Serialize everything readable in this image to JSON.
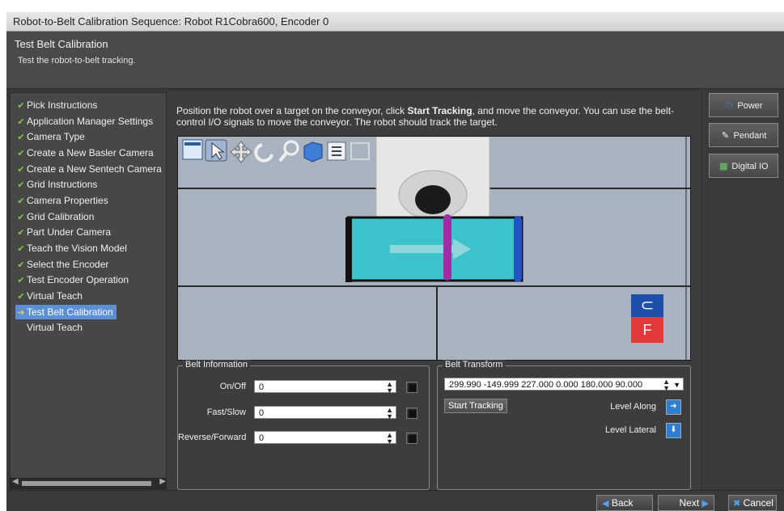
{
  "window": {
    "title": "Robot-to-Belt Calibration Sequence: Robot R1Cobra600, Encoder 0"
  },
  "header": {
    "title": "Test Belt Calibration",
    "subtitle": "Test the robot-to-belt tracking."
  },
  "steps": [
    {
      "label": "Pick Instructions",
      "state": "done"
    },
    {
      "label": "Application Manager Settings",
      "state": "done"
    },
    {
      "label": "Camera Type",
      "state": "done"
    },
    {
      "label": "Create a New Basler Camera",
      "state": "done"
    },
    {
      "label": "Create a New Sentech Camera",
      "state": "done"
    },
    {
      "label": "Grid Instructions",
      "state": "done"
    },
    {
      "label": "Camera Properties",
      "state": "done"
    },
    {
      "label": "Grid Calibration",
      "state": "done"
    },
    {
      "label": "Part Under Camera",
      "state": "done"
    },
    {
      "label": "Teach the Vision Model",
      "state": "done"
    },
    {
      "label": "Select the Encoder",
      "state": "done"
    },
    {
      "label": "Test Encoder Operation",
      "state": "done"
    },
    {
      "label": "Virtual Teach",
      "state": "done"
    },
    {
      "label": "Test Belt Calibration",
      "state": "current"
    },
    {
      "label": "Virtual Teach",
      "state": "pending"
    }
  ],
  "instruction": {
    "part1": "Position the robot over a target on the conveyor, click ",
    "bold": "Start Tracking",
    "part2": ", and move the conveyor. You can use the belt-control I/O signals to move the conveyor.  The robot should track the target."
  },
  "viewport": {
    "toolbar_icons": [
      "window-icon",
      "pointer-icon",
      "move-icon",
      "rotate-icon",
      "zoom-icon",
      "cube-icon",
      "properties-icon",
      "frame-icon"
    ],
    "overlay": {
      "top_glyph": "⊂",
      "bottom_glyph": "F",
      "top_color": "#1f4fa8",
      "bottom_color": "#e23a3a"
    }
  },
  "belt_info": {
    "legend": "Belt Information",
    "rows": [
      {
        "label": "On/Off",
        "value": "0"
      },
      {
        "label": "Fast/Slow",
        "value": "0"
      },
      {
        "label": "Reverse/Forward",
        "value": "0"
      }
    ]
  },
  "belt_transform": {
    "legend": "Belt Transform",
    "value": "299.990 -149.999 227.000 0.000 180.000 90.000",
    "start_tracking": "Start Tracking",
    "level_along": "Level Along",
    "level_lateral": "Level Lateral"
  },
  "side_buttons": {
    "power": "Power",
    "pendant": "Pendant",
    "digital_io": "Digital IO"
  },
  "nav": {
    "back": "Back",
    "next": "Next",
    "cancel": "Cancel"
  },
  "colors": {
    "accent": "#5b8fd8",
    "check": "#7fc94a",
    "conveyor_part": "#2cc6cf",
    "marker_purple": "#9b2fa8",
    "marker_blue": "#2254c4"
  }
}
